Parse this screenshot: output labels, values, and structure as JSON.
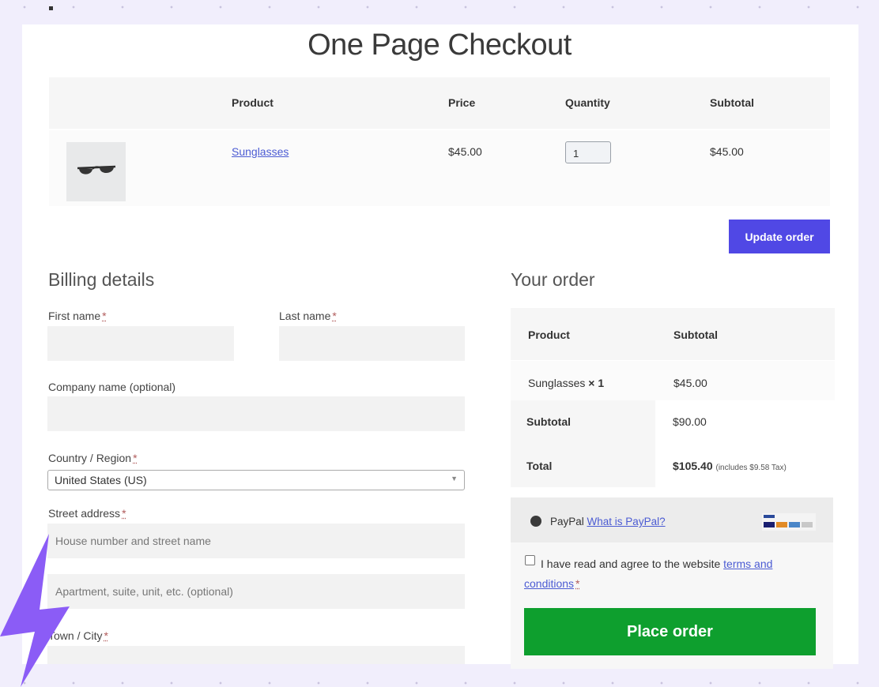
{
  "page": {
    "title": "One Page Checkout"
  },
  "cart": {
    "headers": {
      "product": "Product",
      "price": "Price",
      "quantity": "Quantity",
      "subtotal": "Subtotal"
    },
    "item": {
      "name": "Sunglasses",
      "price": "$45.00",
      "quantity": "1",
      "subtotal": "$45.00"
    },
    "update_button": "Update order"
  },
  "billing": {
    "title": "Billing details",
    "first_name_label": "First name",
    "last_name_label": "Last name",
    "company_label": "Company name (optional)",
    "country_label": "Country / Region",
    "country_value": "United States (US)",
    "street_label": "Street address",
    "street_placeholder": "House number and street name",
    "apartment_placeholder": "Apartment, suite, unit, etc. (optional)",
    "city_label": "Town / City",
    "required_mark": "*"
  },
  "order": {
    "title": "Your order",
    "headers": {
      "product": "Product",
      "subtotal": "Subtotal"
    },
    "item_name": "Sunglasses",
    "item_qty": "× 1",
    "item_subtotal": "$45.00",
    "subtotal_label": "Subtotal",
    "subtotal_value": "$90.00",
    "total_label": "Total",
    "total_value": "$105.40",
    "tax_note": "(includes $9.58 Tax)"
  },
  "payment": {
    "method": "PayPal",
    "what_link": "What is PayPal?",
    "terms_text": "I have read and agree to the website",
    "terms_link": "terms and conditions",
    "place_order": "Place order"
  },
  "colors": {
    "primary_button": "#5048e5",
    "place_order": "#0e9f2e",
    "link": "#4b5bd3",
    "accent_bolt": "#8b5cf6"
  }
}
